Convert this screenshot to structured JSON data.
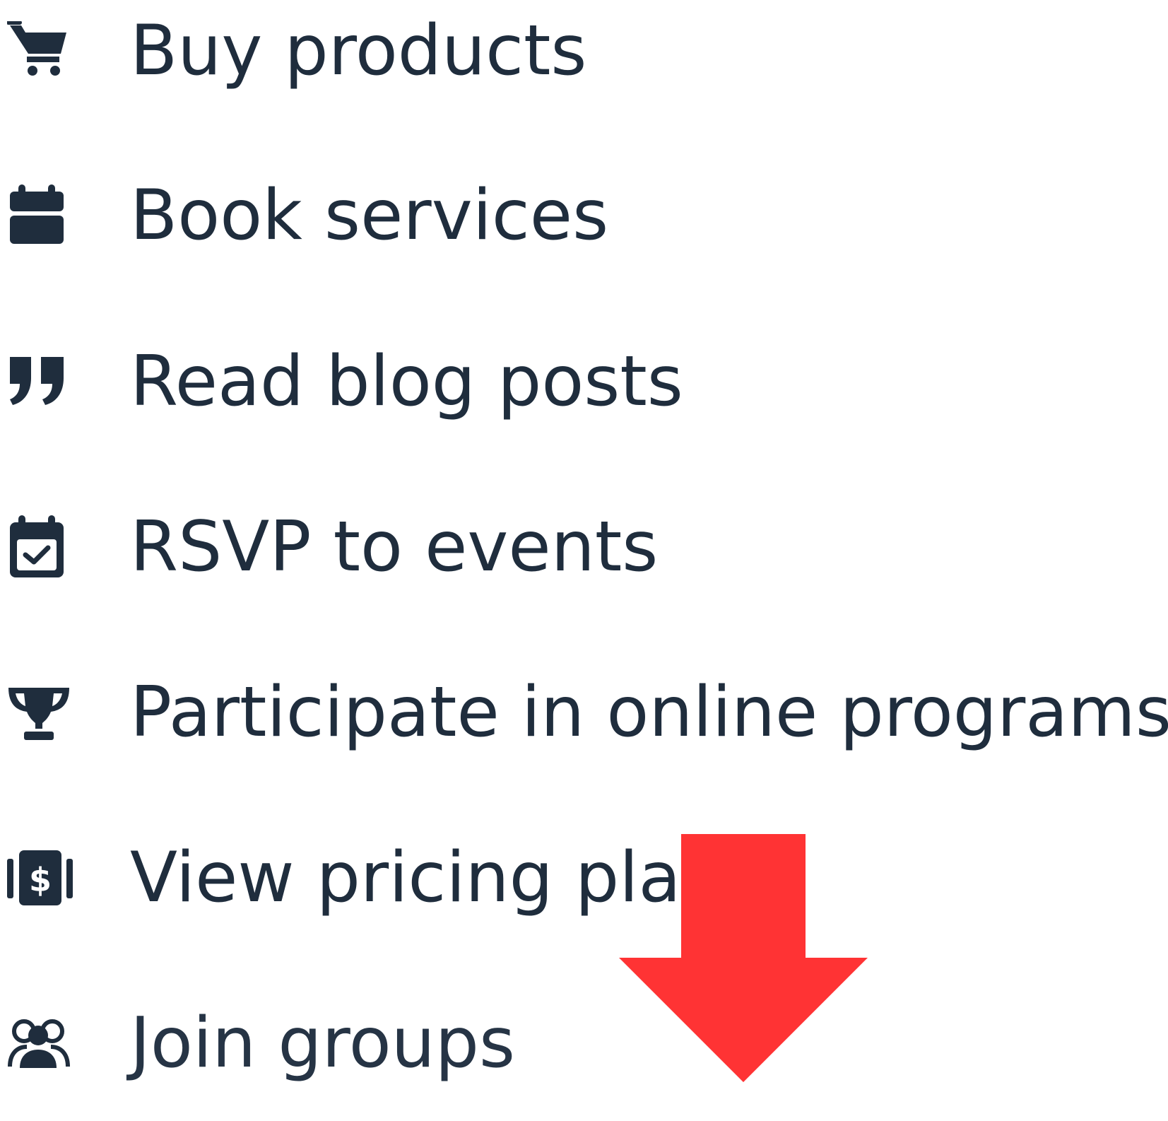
{
  "features": {
    "items": [
      {
        "label": "Buy products",
        "icon": "cart-icon"
      },
      {
        "label": "Book services",
        "icon": "calendar-icon"
      },
      {
        "label": "Read blog posts",
        "icon": "quote-icon"
      },
      {
        "label": "RSVP to events",
        "icon": "calendar-check-icon"
      },
      {
        "label": "Participate in online programs",
        "icon": "trophy-icon"
      },
      {
        "label": "View pricing pla",
        "icon": "pricing-plan-icon"
      },
      {
        "label": "Join groups",
        "icon": "groups-icon"
      }
    ]
  },
  "annotation": {
    "arrow_color": "#ff3334",
    "arrow_direction": "down"
  },
  "colors": {
    "text": "#1f2d3d",
    "icon": "#1f2d3d",
    "background": "#ffffff"
  }
}
